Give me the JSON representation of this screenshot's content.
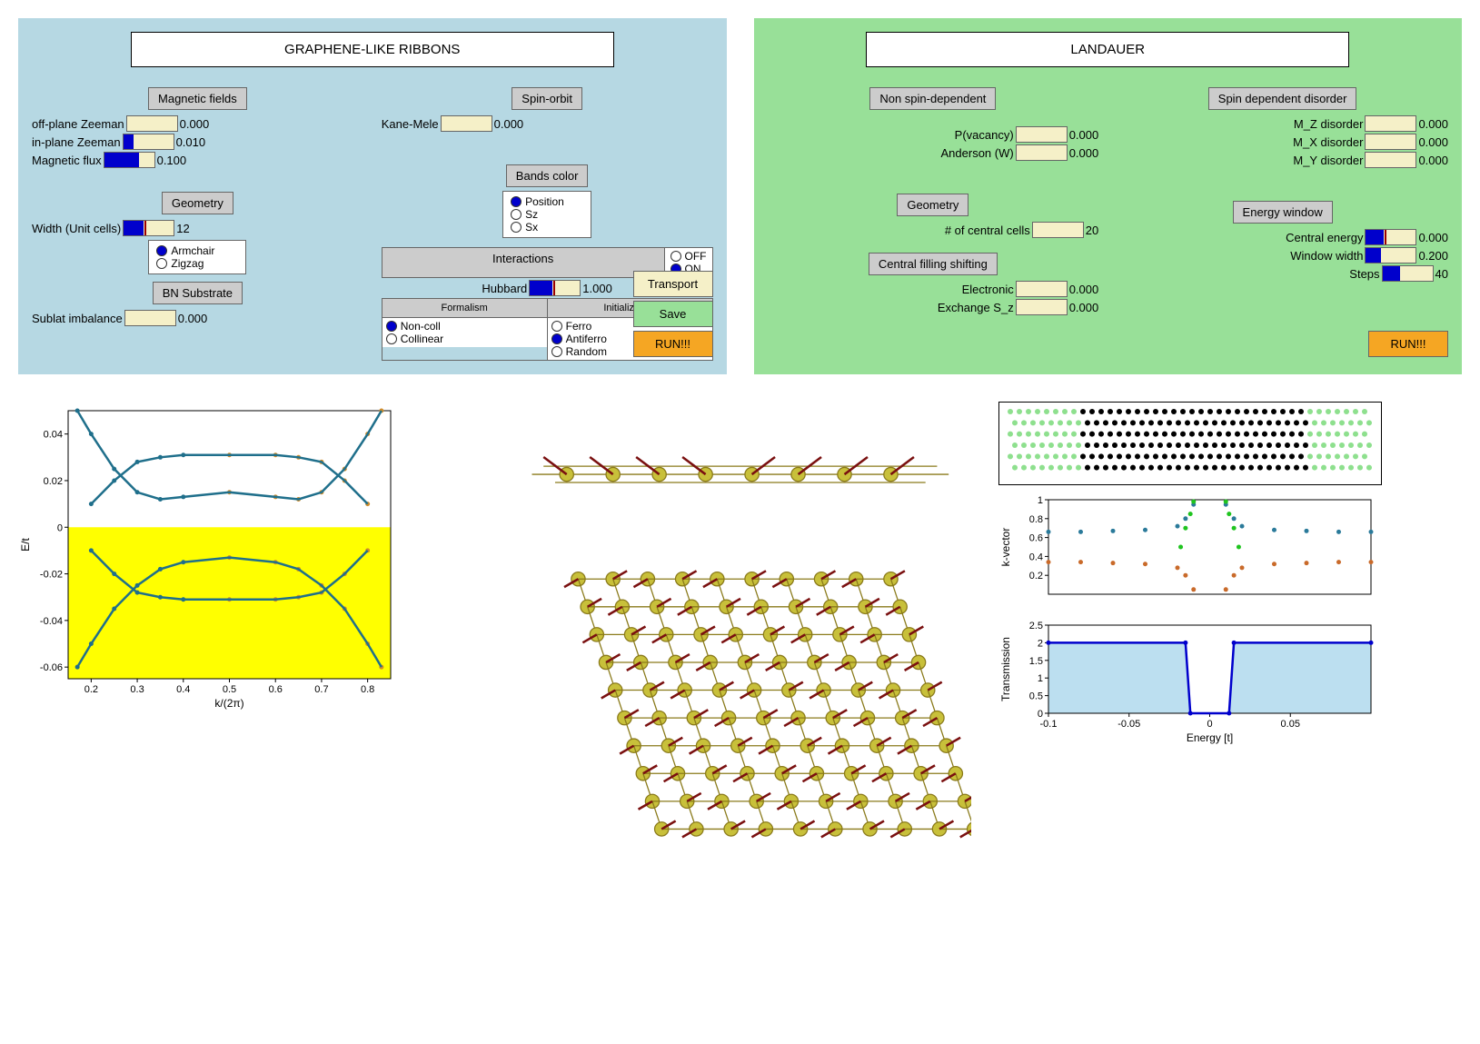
{
  "left_panel": {
    "title": "GRAPHENE-LIKE RIBBONS",
    "magnetic": {
      "header": "Magnetic fields",
      "off_plane_label": "off-plane Zeeman",
      "off_plane_val": "0.000",
      "in_plane_label": "in-plane Zeeman",
      "in_plane_val": "0.010",
      "flux_label": "Magnetic flux",
      "flux_val": "0.100"
    },
    "spin_orbit": {
      "header": "Spin-orbit",
      "kane_label": "Kane-Mele",
      "kane_val": "0.000"
    },
    "bands_color": {
      "header": "Bands color",
      "opts": [
        "Position",
        "Sz",
        "Sx"
      ],
      "selected": 0
    },
    "geometry": {
      "header": "Geometry",
      "width_label": "Width (Unit cells)",
      "width_val": "12",
      "edge_opts": [
        "Armchair",
        "Zigzag"
      ],
      "edge_selected": 0
    },
    "interactions": {
      "header": "Interactions",
      "onoff_opts": [
        "OFF",
        "ON"
      ],
      "onoff_selected": 1,
      "hubbard_label": "Hubbard",
      "hubbard_val": "1.000",
      "formalism_header": "Formalism",
      "init_header": "Initialization",
      "formalism_opts": [
        "Non-coll",
        "Collinear"
      ],
      "formalism_selected": 0,
      "init_opts": [
        "Ferro",
        "Antiferro",
        "Random"
      ],
      "init_selected": 1
    },
    "bn": {
      "header": "BN Substrate",
      "sublat_label": "Sublat imbalance",
      "sublat_val": "0.000"
    },
    "buttons": {
      "transport": "Transport",
      "save": "Save",
      "run": "RUN!!!"
    }
  },
  "right_panel": {
    "title": "LANDAUER",
    "nonspin": {
      "header": "Non spin-dependent",
      "pvac_label": "P(vacancy)",
      "pvac_val": "0.000",
      "anderson_label": "Anderson (W)",
      "anderson_val": "0.000"
    },
    "spindis": {
      "header": "Spin dependent disorder",
      "mz_label": "M_Z disorder",
      "mz_val": "0.000",
      "mx_label": "M_X disorder",
      "mx_val": "0.000",
      "my_label": "M_Y disorder",
      "my_val": "0.000"
    },
    "geometry": {
      "header": "Geometry",
      "cells_label": "# of central cells",
      "cells_val": "20"
    },
    "shift": {
      "header": "Central filling shifting",
      "elec_label": "Electronic",
      "elec_val": "0.000",
      "exch_label": "Exchange S_z",
      "exch_val": "0.000"
    },
    "energy": {
      "header": "Energy window",
      "ce_label": "Central energy",
      "ce_val": "0.000",
      "ww_label": "Window width",
      "ww_val": "0.200",
      "steps_label": "Steps",
      "steps_val": "40"
    },
    "run": "RUN!!!"
  },
  "chart_data": [
    {
      "type": "line",
      "title": "",
      "xlabel": "k/(2π)",
      "ylabel": "E/t",
      "xlim": [
        0.15,
        0.85
      ],
      "ylim": [
        -0.065,
        0.05
      ],
      "xticks": [
        0.2,
        0.3,
        0.4,
        0.5,
        0.6,
        0.7,
        0.8
      ],
      "yticks": [
        -0.06,
        -0.04,
        -0.02,
        0.0,
        0.02,
        0.04
      ],
      "series": [
        {
          "name": "upper-outer",
          "color_gradient": [
            "#1f6f8b",
            "#d08c2a"
          ],
          "x": [
            0.17,
            0.2,
            0.25,
            0.3,
            0.35,
            0.4,
            0.5,
            0.6,
            0.65,
            0.7,
            0.75,
            0.8,
            0.83
          ],
          "y": [
            0.05,
            0.04,
            0.025,
            0.015,
            0.012,
            0.013,
            0.015,
            0.013,
            0.012,
            0.015,
            0.025,
            0.04,
            0.05
          ]
        },
        {
          "name": "upper-inner",
          "color_gradient": [
            "#1f6f8b",
            "#6fd36f",
            "#d08c2a"
          ],
          "x": [
            0.2,
            0.25,
            0.3,
            0.35,
            0.4,
            0.5,
            0.6,
            0.65,
            0.7,
            0.75,
            0.8
          ],
          "y": [
            0.01,
            0.02,
            0.028,
            0.03,
            0.031,
            0.031,
            0.031,
            0.03,
            0.028,
            0.02,
            0.01
          ]
        },
        {
          "name": "lower-inner",
          "color_gradient": [
            "#1f6f8b",
            "#6fd36f",
            "#d08c2a"
          ],
          "x": [
            0.2,
            0.25,
            0.3,
            0.35,
            0.4,
            0.5,
            0.6,
            0.65,
            0.7,
            0.75,
            0.8
          ],
          "y": [
            -0.01,
            -0.02,
            -0.028,
            -0.03,
            -0.031,
            -0.031,
            -0.031,
            -0.03,
            -0.028,
            -0.02,
            -0.01
          ]
        },
        {
          "name": "lower-outer",
          "color_gradient": [
            "#1f6f8b",
            "#d08c2a"
          ],
          "x": [
            0.17,
            0.2,
            0.25,
            0.3,
            0.35,
            0.4,
            0.5,
            0.6,
            0.65,
            0.7,
            0.75,
            0.8,
            0.83
          ],
          "y": [
            -0.06,
            -0.05,
            -0.035,
            -0.025,
            -0.018,
            -0.015,
            -0.013,
            -0.015,
            -0.018,
            -0.025,
            -0.035,
            -0.05,
            -0.06
          ]
        }
      ],
      "shade_below_zero": true
    },
    {
      "type": "scatter",
      "xlabel": "",
      "ylabel": "k-vector",
      "xlim": [
        -0.1,
        0.1
      ],
      "ylim": [
        0.0,
        1.0
      ],
      "yticks": [
        0.2,
        0.4,
        0.6,
        0.8,
        1.0
      ],
      "series": [
        {
          "name": "branch-top",
          "color": "#2a7a9a",
          "x": [
            -0.1,
            -0.08,
            -0.06,
            -0.04,
            -0.02,
            -0.015,
            -0.01,
            0.01,
            0.015,
            0.02,
            0.04,
            0.06,
            0.08,
            0.1
          ],
          "y": [
            0.66,
            0.66,
            0.67,
            0.68,
            0.72,
            0.8,
            0.95,
            0.95,
            0.8,
            0.72,
            0.68,
            0.67,
            0.66,
            0.66
          ]
        },
        {
          "name": "branch-bot",
          "color": "#c96a2a",
          "x": [
            -0.1,
            -0.08,
            -0.06,
            -0.04,
            -0.02,
            -0.015,
            -0.01,
            0.01,
            0.015,
            0.02,
            0.04,
            0.06,
            0.08,
            0.1
          ],
          "y": [
            0.34,
            0.34,
            0.33,
            0.32,
            0.28,
            0.2,
            0.05,
            0.05,
            0.2,
            0.28,
            0.32,
            0.33,
            0.34,
            0.34
          ]
        },
        {
          "name": "green-edge",
          "color": "#1fc41f",
          "x": [
            -0.018,
            -0.015,
            -0.012,
            -0.01,
            0.01,
            0.012,
            0.015,
            0.018
          ],
          "y": [
            0.5,
            0.7,
            0.85,
            0.98,
            0.98,
            0.85,
            0.7,
            0.5
          ]
        }
      ]
    },
    {
      "type": "line",
      "xlabel": "Energy [t]",
      "ylabel": "Transmission",
      "xlim": [
        -0.1,
        0.1
      ],
      "ylim": [
        0.0,
        2.5
      ],
      "xticks": [
        -0.1,
        -0.05,
        0.0,
        0.05
      ],
      "yticks": [
        0.0,
        0.5,
        1.0,
        1.5,
        2.0,
        2.5
      ],
      "fill_color": "#bcdff0",
      "line_color": "#0000cc",
      "series": [
        {
          "name": "T",
          "x": [
            -0.1,
            -0.015,
            -0.012,
            0.012,
            0.015,
            0.1
          ],
          "y": [
            2.0,
            2.0,
            0.0,
            0.0,
            2.0,
            2.0
          ]
        }
      ]
    }
  ]
}
